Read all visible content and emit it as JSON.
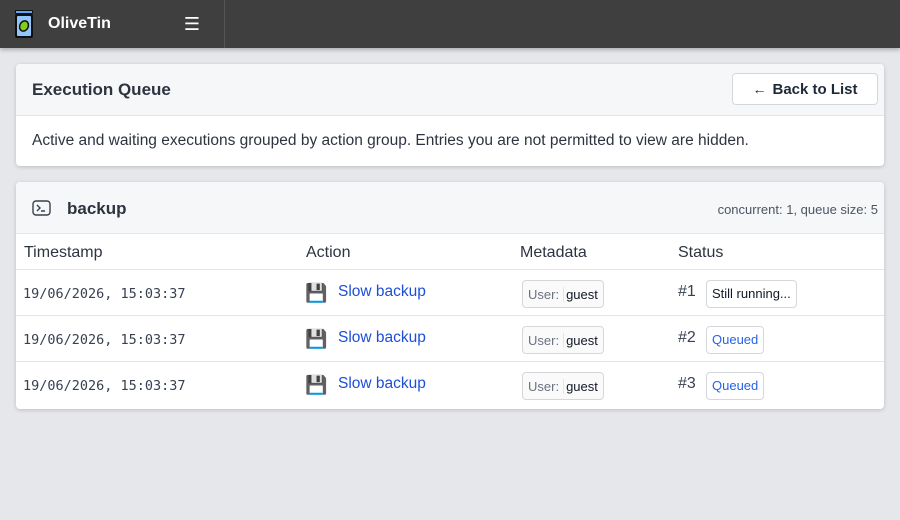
{
  "header": {
    "app_title": "OliveTin",
    "menu_icon": "hamburger-icon",
    "logo_icon": "olive-jar-logo"
  },
  "queue_card": {
    "title": "Execution Queue",
    "back_button_label": "Back to List",
    "back_icon": "arrow-left-icon",
    "description": "Active and waiting executions grouped by action group. Entries you are not permitted to view are hidden."
  },
  "group": {
    "icon": "terminal-icon",
    "name": "backup",
    "meta": "concurrent: 1, queue size: 5",
    "columns": [
      "Timestamp",
      "Action",
      "Metadata",
      "Status"
    ],
    "rows": [
      {
        "timestamp": "19/06/2026, 15:03:37",
        "action_icon": "floppy-disk-icon",
        "action_label": "Slow backup",
        "meta_key": "User:",
        "meta_value": "guest",
        "number": "#1",
        "status": "Still running..."
      },
      {
        "timestamp": "19/06/2026, 15:03:37",
        "action_icon": "floppy-disk-icon",
        "action_label": "Slow backup",
        "meta_key": "User:",
        "meta_value": "guest",
        "number": "#2",
        "status": "Queued"
      },
      {
        "timestamp": "19/06/2026, 15:03:37",
        "action_icon": "floppy-disk-icon",
        "action_label": "Slow backup",
        "meta_key": "User:",
        "meta_value": "guest",
        "number": "#3",
        "status": "Queued"
      }
    ]
  },
  "colors": {
    "header_bg": "#3f3f3f",
    "page_bg": "#e5e7eb",
    "link": "#1d4ed8",
    "queued": "#2563eb"
  }
}
